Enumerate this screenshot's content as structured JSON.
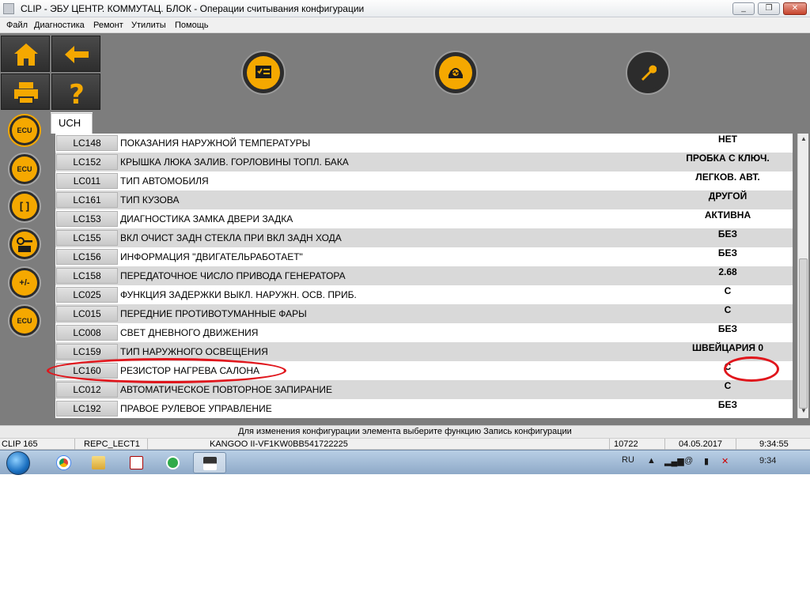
{
  "window": {
    "title": "CLIP - ЭБУ ЦЕНТР. КОММУТАЦ. БЛОК - Операции считывания конфигурации",
    "minimize_label": "_",
    "maximize_label": "❐",
    "close_label": "✕"
  },
  "menu": {
    "items": [
      "Файл",
      "Диагностика",
      "Ремонт",
      "Утилиты",
      "Помощь"
    ]
  },
  "toolbar": {
    "home_icon": "home-icon",
    "back_icon": "arrow-left-icon",
    "print_icon": "printer-icon",
    "help_icon": "help-icon",
    "center_buttons": [
      "checklist-icon",
      "vehicle-diagnostic-icon",
      "wrench-icon"
    ],
    "accent_color": "#f5a800"
  },
  "sidebar": {
    "items": [
      "ECU",
      "ECU",
      "[ ]",
      "key-icon",
      "+/-",
      "ECU"
    ]
  },
  "tab": {
    "label": "UCH"
  },
  "table": {
    "rows": [
      {
        "code": "LC148",
        "desc": "ПОКАЗАНИЯ НАРУЖНОЙ ТЕМПЕРАТУРЫ",
        "value": "НЕТ"
      },
      {
        "code": "LC152",
        "desc": "КРЫШКА ЛЮКА ЗАЛИВ. ГОРЛОВИНЫ ТОПЛ. БАКА",
        "value": "ПРОБКА С КЛЮЧ."
      },
      {
        "code": "LC011",
        "desc": "ТИП АВТОМОБИЛЯ",
        "value": "ЛЕГКОВ. АВТ."
      },
      {
        "code": "LC161",
        "desc": "ТИП КУЗОВА",
        "value": "ДРУГОЙ"
      },
      {
        "code": "LC153",
        "desc": "ДИАГНОСТИКА ЗАМКА ДВЕРИ ЗАДКА",
        "value": "АКТИВНА"
      },
      {
        "code": "LC155",
        "desc": "ВКЛ ОЧИСТ ЗАДН СТЕКЛА ПРИ ВКЛ ЗАДН ХОДА",
        "value": "БЕЗ"
      },
      {
        "code": "LC156",
        "desc": "ИНФОРМАЦИЯ \"ДВИГАТЕЛЬРАБОТАЕТ\"",
        "value": "БЕЗ"
      },
      {
        "code": "LC158",
        "desc": "ПЕРЕДАТОЧНОЕ ЧИСЛО ПРИВОДА ГЕНЕРАТОРА",
        "value": "2.68"
      },
      {
        "code": "LC025",
        "desc": "ФУНКЦИЯ ЗАДЕРЖКИ ВЫКЛ. НАРУЖН. ОСВ. ПРИБ.",
        "value": "С"
      },
      {
        "code": "LC015",
        "desc": "ПЕРЕДНИЕ ПРОТИВОТУМАННЫЕ ФАРЫ",
        "value": "С"
      },
      {
        "code": "LC008",
        "desc": "СВЕТ ДНЕВНОГО ДВИЖЕНИЯ",
        "value": "БЕЗ"
      },
      {
        "code": "LC159",
        "desc": "ТИП НАРУЖНОГО ОСВЕЩЕНИЯ",
        "value": "ШВЕЙЦАРИЯ 0"
      },
      {
        "code": "LC160",
        "desc": "РЕЗИСТОР НАГРЕВА САЛОНА",
        "value": "С"
      },
      {
        "code": "LC012",
        "desc": "АВТОМАТИЧЕСКОЕ ПОВТОРНОЕ ЗАПИРАНИЕ",
        "value": "С"
      },
      {
        "code": "LC192",
        "desc": "ПРАВОЕ РУЛЕВОЕ УПРАВЛЕНИЕ",
        "value": "БЕЗ"
      }
    ],
    "highlight_color": "#e0161c"
  },
  "status": {
    "message": "Для изменения конфигурации элемента выберите функцию Запись конфигурации",
    "clip": "CLIP 165",
    "module": "REPC_LECT1",
    "vehicle": "KANGOO II-VF1KW0BB541722225",
    "number": "10722",
    "date": "04.05.2017",
    "time": "9:34:55"
  },
  "taskbar": {
    "apps": [
      "chrome-icon",
      "explorer-icon",
      "acrobat-icon",
      "greenapp-icon",
      "clip-app-icon"
    ],
    "lang": "RU",
    "clock": "9:34"
  }
}
